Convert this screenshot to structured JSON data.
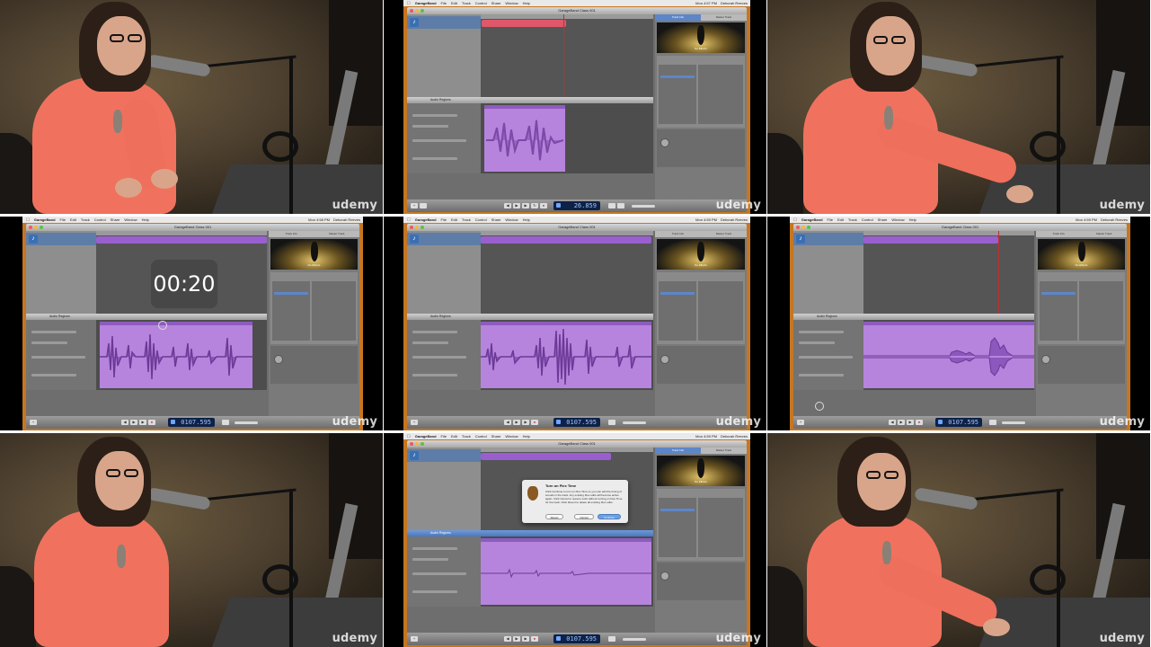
{
  "watermark": "udemy",
  "app": {
    "name": "GarageBand",
    "window_title": "GarageBand Class 001",
    "menus": [
      "File",
      "Edit",
      "Track",
      "Control",
      "Share",
      "Window",
      "Help"
    ],
    "menubar_user": "Deborah Reeves"
  },
  "menubar_times": {
    "a": "Mon 4:57 PM",
    "b": "Mon 4:58 PM",
    "c": "Mon 4:59 PM",
    "d": "Mon 4:59 PM",
    "e": "Mon 4:59 PM"
  },
  "lcd_times": {
    "a": "26.859",
    "b": "0107.595",
    "c": "0107.595",
    "d": "0107.595",
    "e": "0107.595"
  },
  "editor_label": "Audio Regions",
  "right_tabs": [
    "Track Info",
    "Master Track"
  ],
  "preset_label": "No Effects",
  "countdown": "00:20",
  "dialog": {
    "title": "Turn on Flex Time",
    "body": "Click Continue to turn on Flex Time so you can edit the timing of sounds in the track. Any existing Flex edits will become active again. Click Cancel to resume work without turning on Flex Time for the track. Click Revert to delete all existing Flex edits.",
    "revert": "Revert",
    "cancel": "Cancel",
    "continue": "Continue"
  },
  "colors": {
    "region_red": "#e0576a",
    "region_purple": "#b784dd",
    "region_title_purple": "#8e5bbf",
    "selected_blue": "#5d86c8",
    "lcd_background": "#0e2146",
    "screen_border_orange": "#c67620",
    "sweater": "#f0725e"
  },
  "icons": {
    "track_icon": "audio-track-icon",
    "play": "play-icon",
    "record": "record-icon"
  }
}
